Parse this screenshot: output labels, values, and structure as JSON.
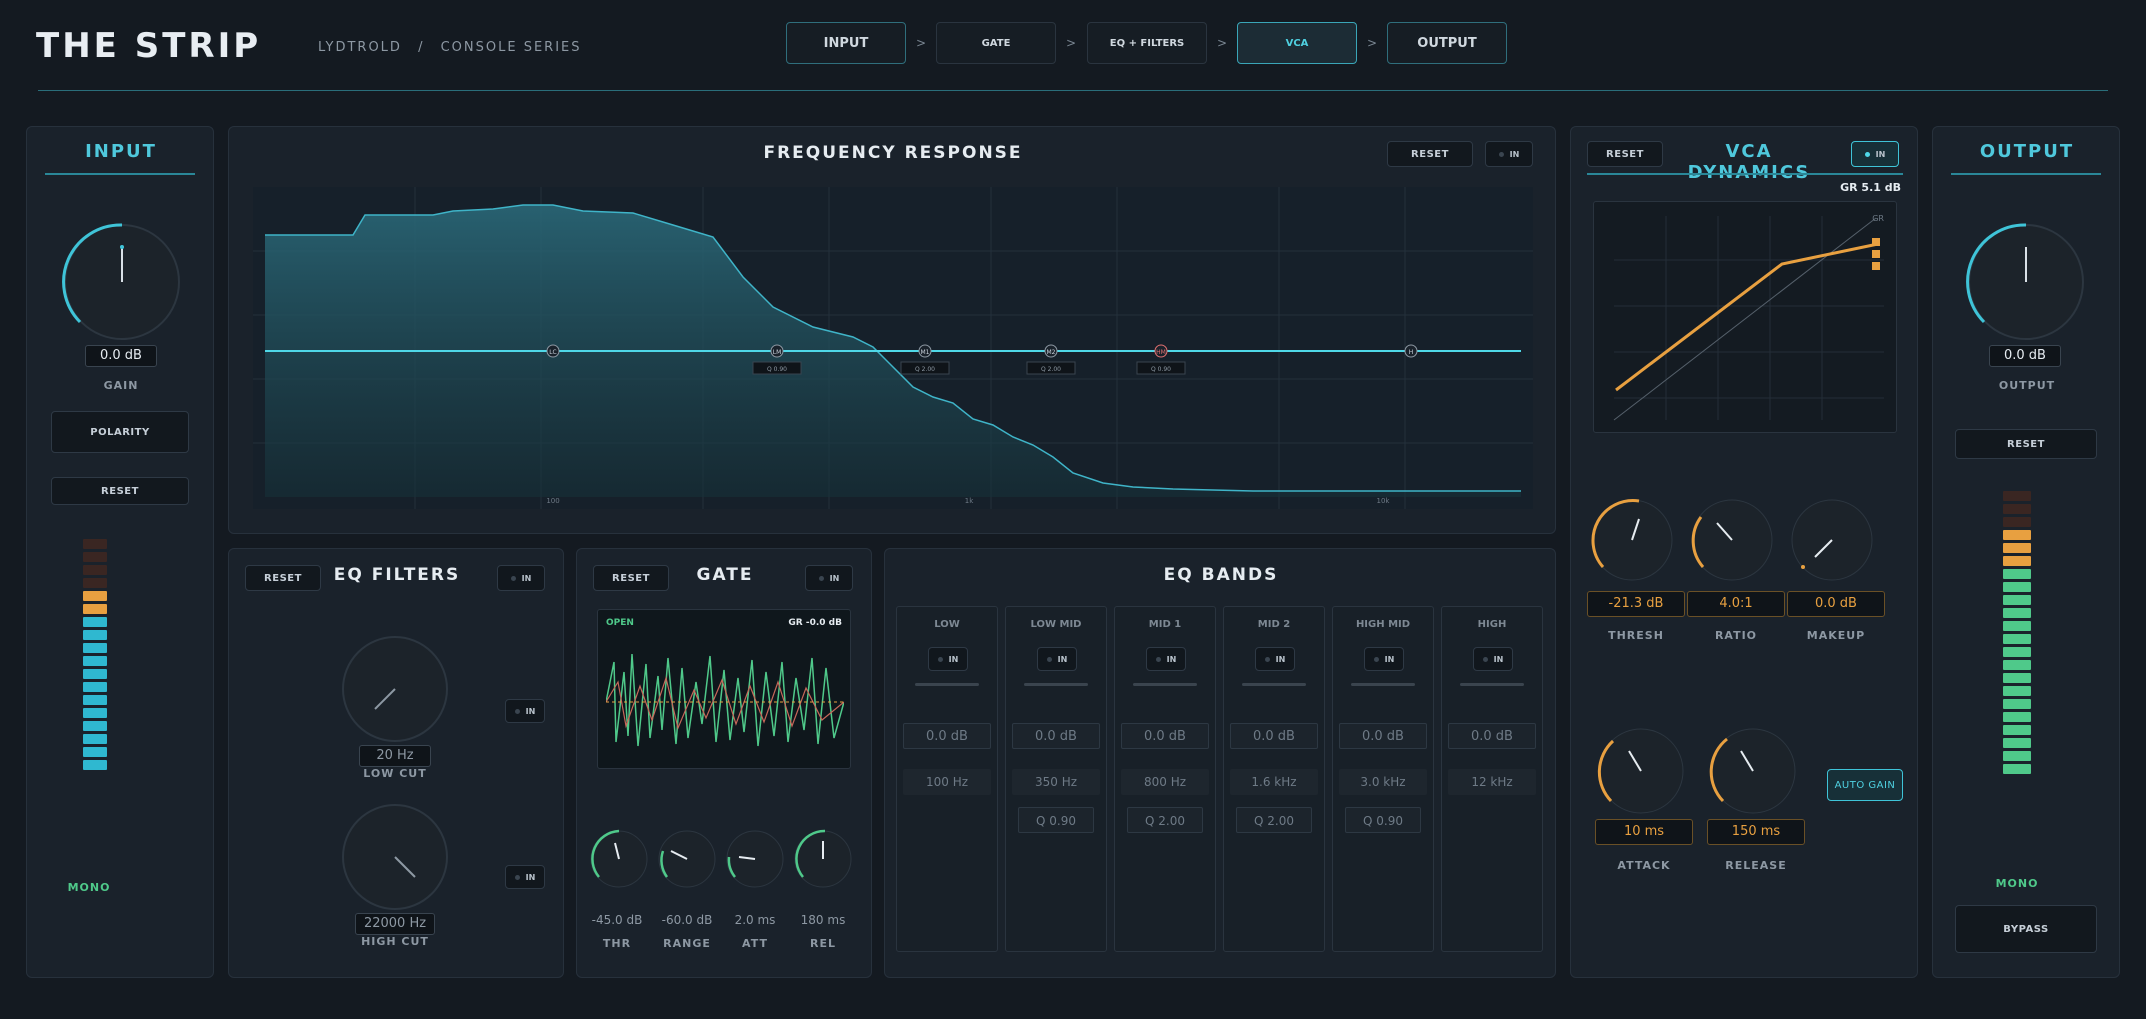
{
  "header": {
    "title": "THE STRIP",
    "brand": "LYDTROLD",
    "series": "CONSOLE SERIES",
    "separator": "/"
  },
  "nav": [
    {
      "label": "INPUT"
    },
    {
      "label": "GATE"
    },
    {
      "label": "EQ + FILTERS"
    },
    {
      "label": "VCA",
      "active": true
    },
    {
      "label": "OUTPUT"
    }
  ],
  "nav_sep": ">",
  "common": {
    "reset": "RESET",
    "in": "IN"
  },
  "input": {
    "title": "INPUT",
    "gain_value": "0.0 dB",
    "gain_label": "GAIN",
    "polarity": "POLARITY",
    "mono": "MONO"
  },
  "freq": {
    "title": "FREQUENCY RESPONSE",
    "node_labels": [
      "LC",
      "LM",
      "M1",
      "M2",
      "HM",
      "H"
    ],
    "q_labels": [
      "Q 0.90",
      "Q 2.00",
      "Q 2.00",
      "Q 0.90"
    ],
    "ticks": [
      "100",
      "1k",
      "10k"
    ]
  },
  "filters": {
    "title": "EQ FILTERS",
    "low_cut_value": "20 Hz",
    "low_cut_label": "LOW CUT",
    "high_cut_value": "22000 Hz",
    "high_cut_label": "HIGH CUT"
  },
  "gate": {
    "title": "GATE",
    "state": "OPEN",
    "gr": "GR -0.0 dB",
    "thr": "-45.0 dB",
    "range": "-60.0 dB",
    "att": "2.0 ms",
    "rel": "180 ms",
    "thr_label": "THR",
    "range_label": "RANGE",
    "att_label": "ATT",
    "rel_label": "REL"
  },
  "bands": {
    "title": "EQ BANDS",
    "items": [
      {
        "name": "LOW",
        "gain": "0.0 dB",
        "freq": "100 Hz",
        "q": ""
      },
      {
        "name": "LOW MID",
        "gain": "0.0 dB",
        "freq": "350 Hz",
        "q": "Q 0.90"
      },
      {
        "name": "MID 1",
        "gain": "0.0 dB",
        "freq": "800 Hz",
        "q": "Q 2.00"
      },
      {
        "name": "MID 2",
        "gain": "0.0 dB",
        "freq": "1.6 kHz",
        "q": "Q 2.00"
      },
      {
        "name": "HIGH MID",
        "gain": "0.0 dB",
        "freq": "3.0 kHz",
        "q": "Q 0.90"
      },
      {
        "name": "HIGH",
        "gain": "0.0 dB",
        "freq": "12 kHz",
        "q": ""
      }
    ]
  },
  "vca": {
    "title": "VCA DYNAMICS",
    "gr": "GR 5.1 dB",
    "graph_label": "GR",
    "thresh": "-21.3 dB",
    "ratio": "4.0:1",
    "makeup": "0.0 dB",
    "attack": "10 ms",
    "release": "150 ms",
    "thresh_label": "THRESH",
    "ratio_label": "RATIO",
    "makeup_label": "MAKEUP",
    "attack_label": "ATTACK",
    "release_label": "RELEASE",
    "auto_gain": "AUTO GAIN"
  },
  "output": {
    "title": "OUTPUT",
    "value": "0.0 dB",
    "label": "OUTPUT",
    "mono": "MONO",
    "bypass": "BYPASS"
  },
  "colors": {
    "accent": "#3fc4d8",
    "orange": "#e8a040",
    "green": "#4fc98a"
  }
}
